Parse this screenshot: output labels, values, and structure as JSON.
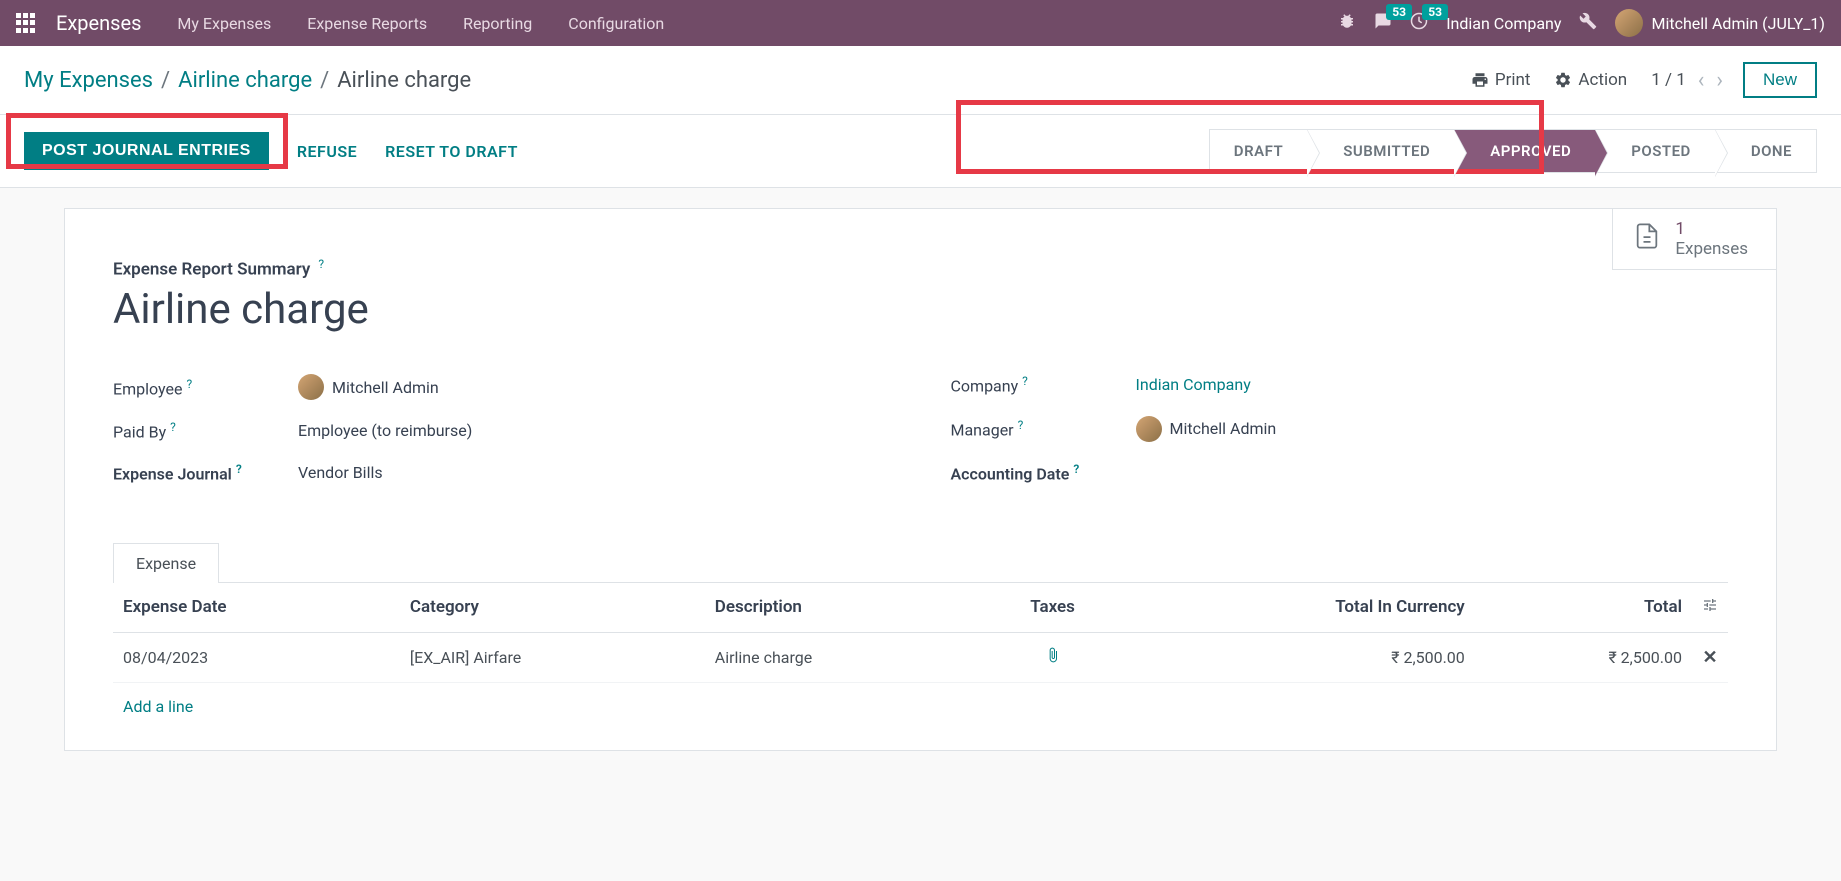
{
  "navbar": {
    "brand": "Expenses",
    "links": [
      "My Expenses",
      "Expense Reports",
      "Reporting",
      "Configuration"
    ],
    "badge_messages": "53",
    "badge_activities": "53",
    "company": "Indian Company",
    "user": "Mitchell Admin (JULY_1)"
  },
  "breadcrumb": {
    "items": [
      "My Expenses",
      "Airline charge",
      "Airline charge"
    ],
    "print": "Print",
    "action": "Action",
    "pager": "1 / 1",
    "new_btn": "New"
  },
  "actions": {
    "post": "POST JOURNAL ENTRIES",
    "refuse": "REFUSE",
    "reset": "RESET TO DRAFT"
  },
  "pipeline": [
    "DRAFT",
    "SUBMITTED",
    "APPROVED",
    "POSTED",
    "DONE"
  ],
  "pipeline_active_index": 2,
  "stat_button": {
    "count": "1",
    "label": "Expenses"
  },
  "form": {
    "summary_label": "Expense Report Summary",
    "title": "Airline charge",
    "employee_label": "Employee",
    "employee_value": "Mitchell Admin",
    "paidby_label": "Paid By",
    "paidby_value": "Employee (to reimburse)",
    "journal_label": "Expense Journal",
    "journal_value": "Vendor Bills",
    "company_label": "Company",
    "company_value": "Indian Company",
    "manager_label": "Manager",
    "manager_value": "Mitchell Admin",
    "acctdate_label": "Accounting Date"
  },
  "tab": {
    "expense": "Expense"
  },
  "table": {
    "headers": {
      "date": "Expense Date",
      "category": "Category",
      "description": "Description",
      "taxes": "Taxes",
      "total_currency": "Total In Currency",
      "total": "Total"
    },
    "rows": [
      {
        "date": "08/04/2023",
        "category": "[EX_AIR] Airfare",
        "description": "Airline charge",
        "total_currency": "₹ 2,500.00",
        "total": "₹ 2,500.00"
      }
    ],
    "add_line": "Add a line"
  }
}
